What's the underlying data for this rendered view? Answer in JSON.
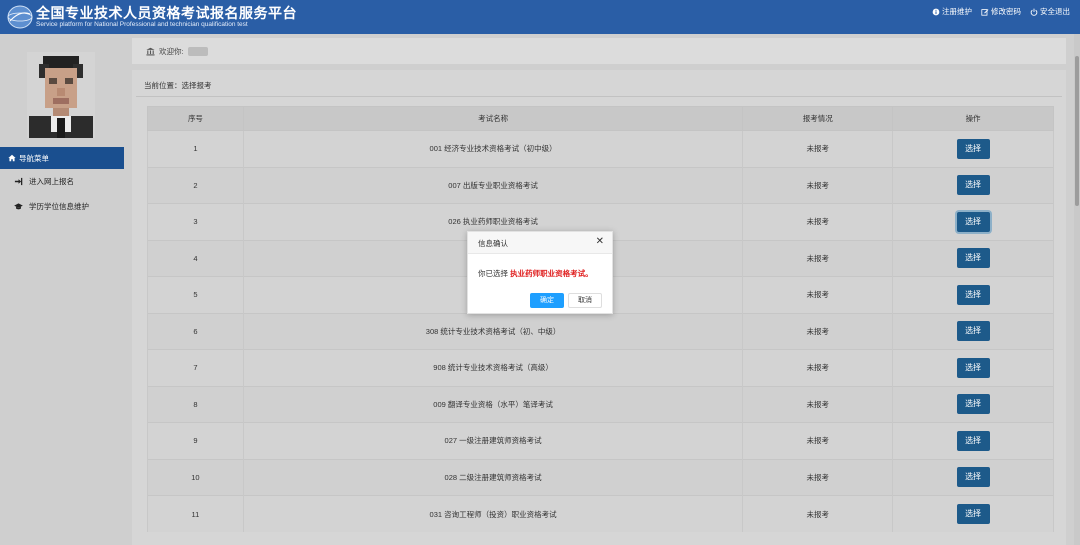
{
  "header": {
    "title": "全国专业技术人员资格考试报名服务平台",
    "subtitle": "Service platform for National Professional and technician qualification test",
    "links": [
      {
        "label": "注册维护",
        "icon": "info-circle-icon"
      },
      {
        "label": "修改密码",
        "icon": "edit-icon"
      },
      {
        "label": "安全退出",
        "icon": "power-icon"
      }
    ]
  },
  "sidebar": {
    "nav_title": "导航菜单",
    "items": [
      {
        "label": "进入网上报名",
        "icon": "sign-in-icon"
      },
      {
        "label": "学历学位信息维护",
        "icon": "graduation-cap-icon"
      }
    ],
    "collapse_glyph": "‹"
  },
  "main": {
    "welcome_label": "欢迎你:",
    "breadcrumb": "当前位置：选择报考",
    "table": {
      "headers": [
        "序号",
        "考试名称",
        "报考情况",
        "操作"
      ],
      "rows": [
        {
          "seq": "1",
          "name": "001 经济专业技术资格考试（初中级）",
          "status": "未报考",
          "action": "选择"
        },
        {
          "seq": "2",
          "name": "007 出版专业职业资格考试",
          "status": "未报考",
          "action": "选择"
        },
        {
          "seq": "3",
          "name": "026 执业药师职业资格考试",
          "status": "未报考",
          "action": "选择"
        },
        {
          "seq": "4",
          "name": "038 社",
          "status": "未报考",
          "action": "选择"
        },
        {
          "seq": "5",
          "name": "046",
          "status": "未报考",
          "action": "选择"
        },
        {
          "seq": "6",
          "name": "308 统计专业技术资格考试（初、中级）",
          "status": "未报考",
          "action": "选择"
        },
        {
          "seq": "7",
          "name": "908 统计专业技术资格考试（高级）",
          "status": "未报考",
          "action": "选择"
        },
        {
          "seq": "8",
          "name": "009 翻译专业资格（水平）笔译考试",
          "status": "未报考",
          "action": "选择"
        },
        {
          "seq": "9",
          "name": "027 一级注册建筑师资格考试",
          "status": "未报考",
          "action": "选择"
        },
        {
          "seq": "10",
          "name": "028 二级注册建筑师资格考试",
          "status": "未报考",
          "action": "选择"
        },
        {
          "seq": "11",
          "name": "031 咨询工程师（投资）职业资格考试",
          "status": "未报考",
          "action": "选择"
        }
      ]
    }
  },
  "modal": {
    "title": "信息确认",
    "close_glyph": "✕",
    "message_prefix": "你已选择 ",
    "message_highlight": "执业药师职业资格考试。",
    "ok_label": "确定",
    "cancel_label": "取消"
  },
  "colors": {
    "header_bg": "#2a5ea6",
    "nav_active": "#1a4f8f",
    "select_button": "#1d5a8a",
    "ok_button": "#1e9fff",
    "highlight_red": "#e02020"
  }
}
